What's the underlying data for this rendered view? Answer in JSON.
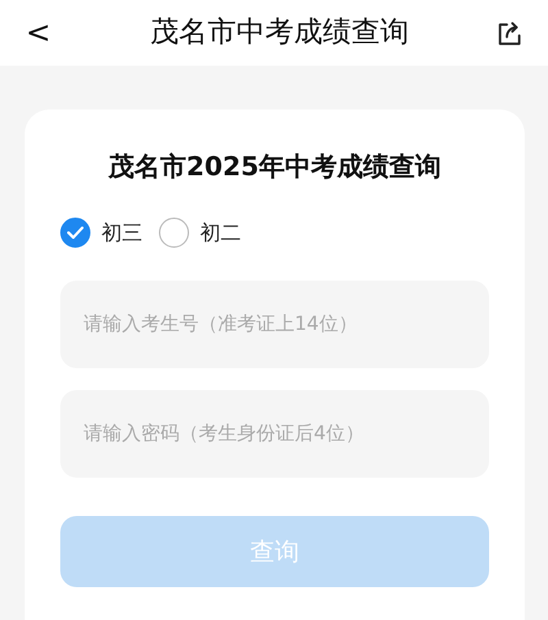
{
  "header": {
    "back": "<",
    "title": "茂名市中考成绩查询"
  },
  "card": {
    "title": "茂名市2025年中考成绩查询",
    "grades": [
      {
        "label": "初三",
        "selected": true
      },
      {
        "label": "初二",
        "selected": false
      }
    ],
    "fields": [
      {
        "placeholder": "请输入考生号（准考证上14位）"
      },
      {
        "placeholder": "请输入密码（考生身份证后4位）"
      }
    ],
    "submit": {
      "label": "查询",
      "disabled": true
    }
  }
}
